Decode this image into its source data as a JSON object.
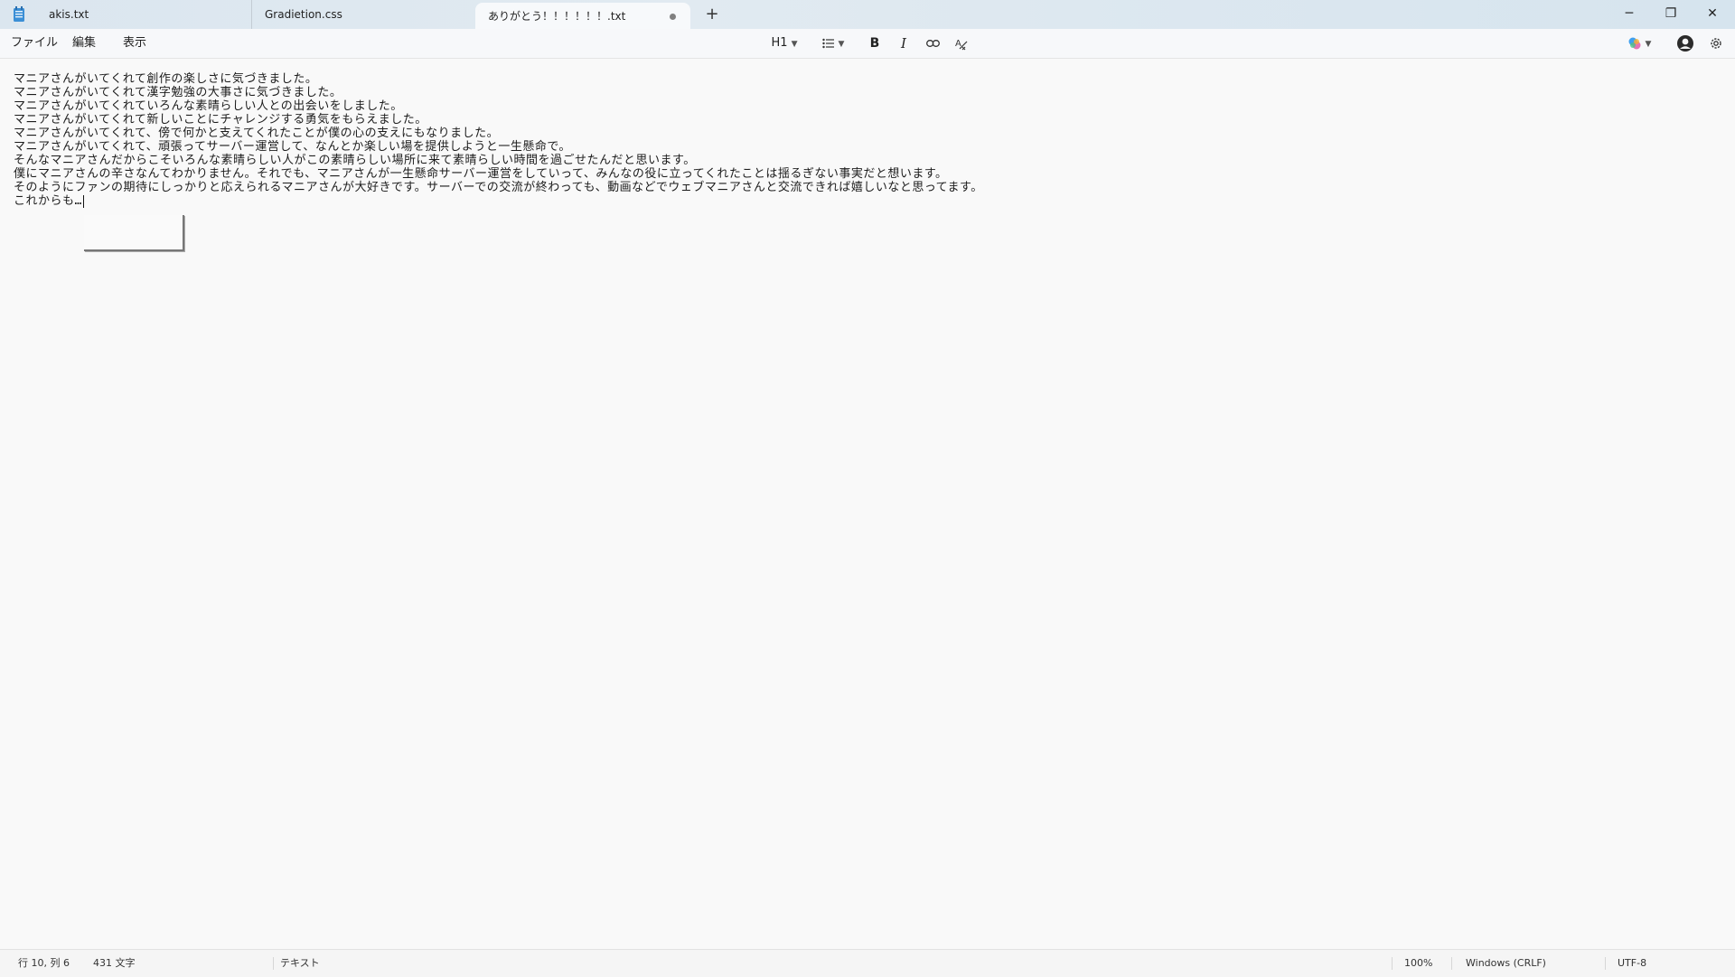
{
  "tabs": [
    {
      "label": "akis.txt"
    },
    {
      "label": "Gradietion.css"
    },
    {
      "label": "ありがとう！！！！！！.txt",
      "unsaved": true
    }
  ],
  "new_tab_symbol": "+",
  "window_controls": {
    "minimize": "─",
    "maximize": "❐",
    "close": "✕"
  },
  "menu": {
    "file": "ファイル",
    "edit": "編集",
    "view": "表示"
  },
  "toolbar": {
    "heading": "H1",
    "list_icon": "list-icon",
    "bold": "B",
    "italic": "I",
    "link_icon": "link-icon",
    "clear_format_icon": "clear-format-icon",
    "copilot_icon": "copilot-icon",
    "account_icon": "account-icon",
    "settings_icon": "gear-icon"
  },
  "editor": {
    "lines": [
      "マニアさんがいてくれて創作の楽しさに気づきました。",
      "マニアさんがいてくれて漢字勉強の大事さに気づきました。",
      "マニアさんがいてくれていろんな素晴らしい人との出会いをしました。",
      "マニアさんがいてくれて新しいことにチャレンジする勇気をもらえました。",
      "マニアさんがいてくれて、傍で何かと支えてくれたことが僕の心の支えにもなりました。",
      "マニアさんがいてくれて、頑張ってサーバー運営して、なんとか楽しい場を提供しようと一生懸命で。",
      "そんなマニアさんだからこそいろんな素晴らしい人がこの素晴らしい場所に来て素晴らしい時間を過ごせたんだと思います。",
      "僕にマニアさんの辛さなんてわかりません。それでも、マニアさんが一生懸命サーバー運営をしていって、みんなの役に立ってくれたことは揺るぎない事実だと想います。",
      "そのようにファンの期待にしっかりと応えられるマニアさんが大好きです。サーバーでの交流が終わっても、動画などでウェブマニアさんと交流できれば嬉しいなと思ってます。",
      "これからも…"
    ]
  },
  "status": {
    "position": "行 10, 列 6",
    "char_count": "431 文字",
    "format": "テキスト",
    "zoom": "100%",
    "line_ending": "Windows (CRLF)",
    "encoding": "UTF-8"
  }
}
